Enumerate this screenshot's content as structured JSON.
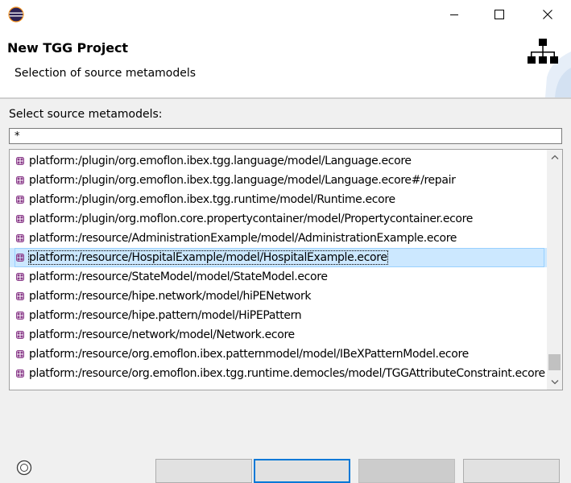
{
  "window": {
    "close_glyph": "✕"
  },
  "header": {
    "title": "New TGG Project",
    "description": "Selection of source metamodels"
  },
  "form": {
    "label": "Select source metamodels:",
    "filter_value": "*"
  },
  "metamodels": [
    {
      "label": "platform:/plugin/org.emoflon.ibex.tgg.language/model/Language.ecore",
      "selected": false
    },
    {
      "label": "platform:/plugin/org.emoflon.ibex.tgg.language/model/Language.ecore#/repair",
      "selected": false
    },
    {
      "label": "platform:/plugin/org.emoflon.ibex.tgg.runtime/model/Runtime.ecore",
      "selected": false
    },
    {
      "label": "platform:/plugin/org.moflon.core.propertycontainer/model/Propertycontainer.ecore",
      "selected": false
    },
    {
      "label": "platform:/resource/AdministrationExample/model/AdministrationExample.ecore",
      "selected": false
    },
    {
      "label": "platform:/resource/HospitalExample/model/HospitalExample.ecore",
      "selected": true
    },
    {
      "label": "platform:/resource/StateModel/model/StateModel.ecore",
      "selected": false
    },
    {
      "label": "platform:/resource/hipe.network/model/hiPENetwork",
      "selected": false
    },
    {
      "label": "platform:/resource/hipe.pattern/model/HiPEPattern",
      "selected": false
    },
    {
      "label": "platform:/resource/network/model/Network.ecore",
      "selected": false
    },
    {
      "label": "platform:/resource/org.emoflon.ibex.patternmodel/model/IBeXPatternModel.ecore",
      "selected": false
    },
    {
      "label": "platform:/resource/org.emoflon.ibex.tgg.runtime.democles/model/TGGAttributeConstraint.ecore",
      "selected": false
    }
  ],
  "icons": {
    "app": "eclipse-icon",
    "item": "package-icon",
    "wizard": "hierarchy-icon"
  },
  "colors": {
    "selection": "#cce8ff",
    "item_icon": "#8b3d8b"
  }
}
